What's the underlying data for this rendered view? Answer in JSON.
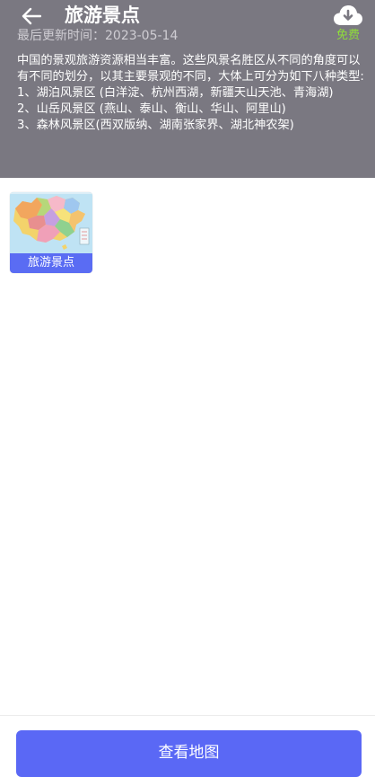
{
  "header": {
    "title": "旅游景点",
    "updated_text": "最后更新时间：2023-05-14",
    "download_badge": "免费",
    "back_icon": "arrow-left-icon",
    "download_icon": "cloud-download-icon",
    "background_color": "#7a7881",
    "badge_color": "#8fdd3a"
  },
  "description": "中国的景观旅游资源相当丰富。这些风景名胜区从不同的角度可以有不同的划分，以其主要景观的不同，大体上可分为如下八种类型:\n1、湖泊风景区 (白洋淀、杭州西湖，新疆天山天池、青海湖)\n2、山岳风景区 (燕山、泰山、衡山、华山、阿里山)\n3、森林风景区(西双版纳、湖南张家界、湖北神农架)",
  "thumbnail": {
    "label": "旅游景点",
    "image_icon": "china-map-thumbnail",
    "label_color": "#5a6cf3"
  },
  "footer": {
    "view_map_label": "查看地图",
    "button_color": "#5a68f5"
  }
}
